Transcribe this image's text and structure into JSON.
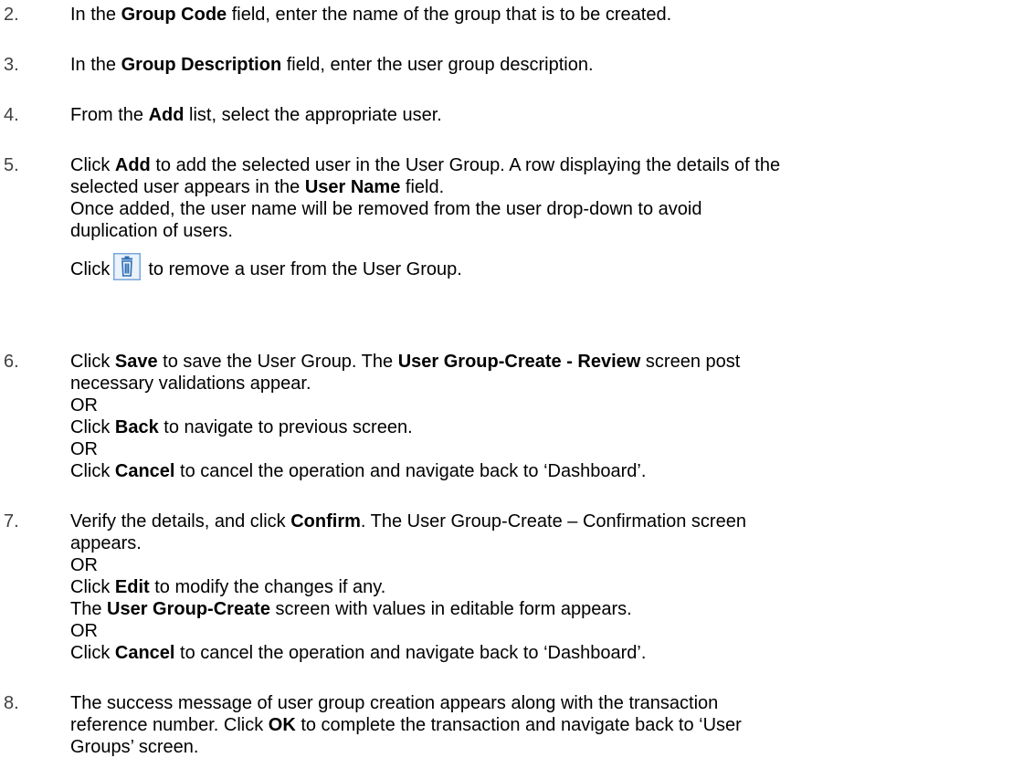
{
  "steps": [
    {
      "number": "2.",
      "lines": [
        {
          "t1": "In the ",
          "b1": "Group Code",
          "t2": " field, enter the name of the group that is to be created."
        }
      ]
    },
    {
      "number": "3.",
      "lines": [
        {
          "t1": "In the ",
          "b1": "Group Description",
          "t2": " field, enter the user group description."
        }
      ]
    },
    {
      "number": "4.",
      "lines": [
        {
          "t1": "From the ",
          "b1": "Add",
          "t2": " list, select the appropriate user."
        }
      ]
    },
    {
      "number": "5.",
      "lines": [
        {
          "t1": "Click ",
          "b1": "Add",
          "t2": " to add the selected user in the User Group. A row displaying the details of the"
        },
        {
          "t1": "selected user appears in the ",
          "b1": "User Name",
          "t2": " field."
        },
        {
          "t1": "Once added, the user name will be removed from the user drop-down to avoid"
        },
        {
          "t1": "duplication of users."
        }
      ],
      "icon_line": {
        "before": "Click",
        "after": "to remove a user from the User Group.",
        "icon": "trash-icon"
      }
    },
    {
      "number": "6.",
      "lines": [
        {
          "t1": "Click ",
          "b1": "Save",
          "t2": " to save the User Group. The ",
          "b2": "User Group-Create - Review",
          "t3": " screen post"
        },
        {
          "t1": "necessary validations appear."
        },
        {
          "t1": "OR"
        },
        {
          "t1": "Click ",
          "b1": "Back",
          "t2": " to navigate to previous screen."
        },
        {
          "t1": "OR"
        },
        {
          "t1": "Click ",
          "b1": "Cancel",
          "t2": " to cancel the operation and navigate back to ‘Dashboard’."
        }
      ]
    },
    {
      "number": "7.",
      "lines": [
        {
          "t1": "Verify the details, and click ",
          "b1": "Confirm",
          "t2": ". The User Group-Create – Confirmation screen"
        },
        {
          "t1": "appears."
        },
        {
          "t1": "OR"
        },
        {
          "t1": "Click ",
          "b1": "Edit",
          "t2": " to modify the changes if any."
        },
        {
          "t1": "The ",
          "b1": "User Group-Create",
          "t2": " screen with values in editable form appears."
        },
        {
          "t1": "OR"
        },
        {
          "t1": "Click ",
          "b1": "Cancel",
          "t2": " to cancel the operation and navigate back to ‘Dashboard’."
        }
      ]
    },
    {
      "number": "8.",
      "lines": [
        {
          "t1": "The success message of user group creation appears along with the transaction"
        },
        {
          "t1": "reference number. Click ",
          "b1": "OK",
          "t2": " to complete the transaction and navigate back to ‘User"
        },
        {
          "t1": "Groups’ screen."
        }
      ]
    }
  ],
  "colors": {
    "text": "#000000",
    "number": "#404040",
    "icon_border": "#7aa7d8",
    "icon_fill": "#eaf2fb",
    "icon_stroke": "#2f6fb5"
  }
}
